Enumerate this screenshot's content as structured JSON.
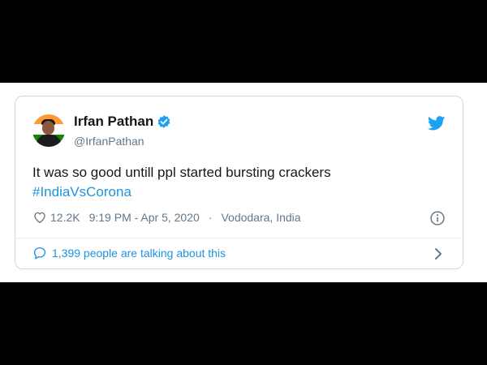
{
  "tweet": {
    "author_name": "Irfan Pathan",
    "author_handle": "@IrfanPathan",
    "text": "It was so good untill ppl started bursting crackers",
    "hashtag": "#IndiaVsCorona",
    "likes": "12.2K",
    "timestamp": "9:19 PM - Apr 5, 2020",
    "separator": "·",
    "location": "Vododara, India",
    "talking": "1,399 people are talking about this"
  },
  "icons": {
    "verified": "verified-badge-icon",
    "bird": "twitter-bird-icon",
    "like": "heart-icon",
    "info": "info-icon",
    "reply": "speech-bubble-icon",
    "chevron": "chevron-right-icon"
  },
  "colors": {
    "brand": "#1da1f2",
    "link": "#1b95e0",
    "text": "#14171a",
    "muted": "#657786"
  }
}
